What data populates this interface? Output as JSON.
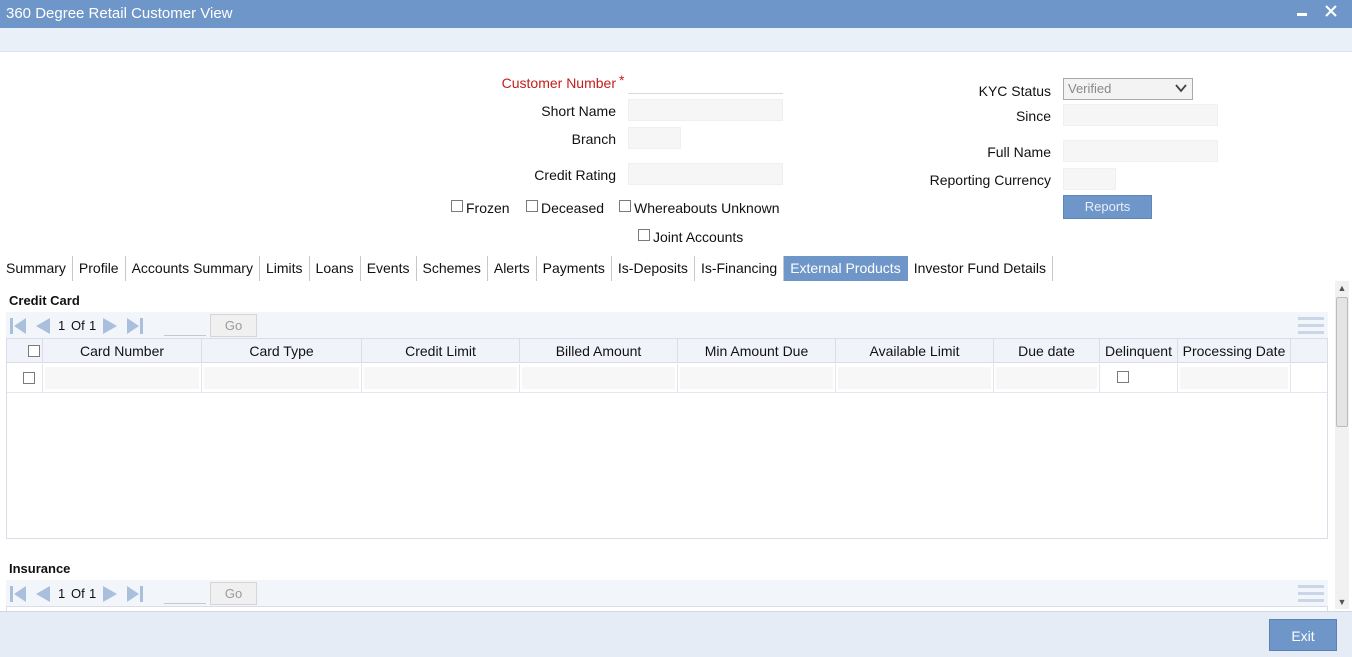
{
  "window": {
    "title": "360 Degree Retail Customer View",
    "minimize_icon": "minimize-icon",
    "close_icon": "close-icon"
  },
  "form": {
    "customer_number_label": "Customer Number",
    "required_mark": "*",
    "short_name_label": "Short Name",
    "branch_label": "Branch",
    "credit_rating_label": "Credit Rating",
    "kyc_status_label": "KYC Status",
    "kyc_status_value": "Verified",
    "since_label": "Since",
    "full_name_label": "Full Name",
    "reporting_currency_label": "Reporting Currency",
    "reports_button": "Reports",
    "frozen_label": "Frozen",
    "deceased_label": "Deceased",
    "whereabouts_label": "Whereabouts Unknown",
    "joint_accounts_label": "Joint Accounts"
  },
  "tabs": [
    {
      "label": "Summary",
      "active": false
    },
    {
      "label": "Profile",
      "active": false
    },
    {
      "label": "Accounts Summary",
      "active": false
    },
    {
      "label": "Limits",
      "active": false
    },
    {
      "label": "Loans",
      "active": false
    },
    {
      "label": "Events",
      "active": false
    },
    {
      "label": "Schemes",
      "active": false
    },
    {
      "label": "Alerts",
      "active": false
    },
    {
      "label": "Payments",
      "active": false
    },
    {
      "label": "Is-Deposits",
      "active": false
    },
    {
      "label": "Is-Financing",
      "active": false
    },
    {
      "label": "External Products",
      "active": true
    },
    {
      "label": "Investor Fund Details",
      "active": false
    }
  ],
  "credit_card": {
    "title": "Credit Card",
    "pager": {
      "current": "1",
      "of_label": "Of",
      "total": "1",
      "go_label": "Go"
    },
    "columns": [
      "Card Number",
      "Card Type",
      "Credit Limit",
      "Billed Amount",
      "Min Amount Due",
      "Available Limit",
      "Due date",
      "Delinquent",
      "Processing Date"
    ]
  },
  "insurance": {
    "title": "Insurance",
    "pager": {
      "current": "1",
      "of_label": "Of",
      "total": "1",
      "go_label": "Go"
    }
  },
  "footer": {
    "exit_label": "Exit"
  },
  "colors": {
    "accent": "#6f96c8",
    "required": "#c41d1d"
  }
}
